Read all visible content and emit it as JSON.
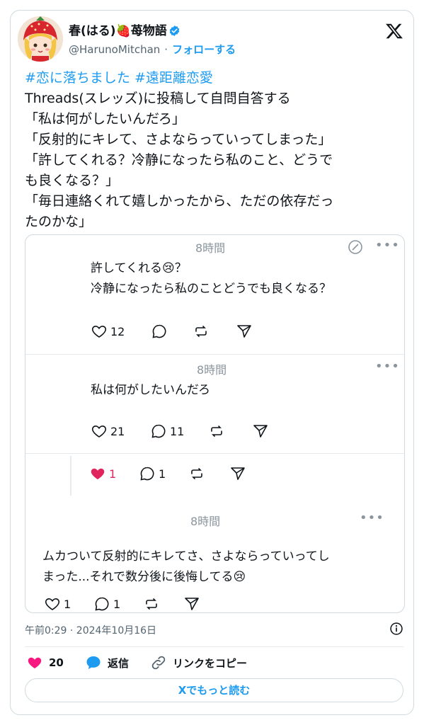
{
  "user": {
    "name": "春(はる)🍓苺物語",
    "handle": "@HarunoMitchan",
    "separator": "·",
    "follow": "フォローする"
  },
  "tweet": {
    "hashtag1": "#恋に落ちました",
    "hashtag2": "#遠距離恋愛",
    "lines": [
      "Threads(スレッズ)に投稿して自問自答する",
      "「私は何がしたいんだろ」",
      "「反射的にキレて、さよならっていってしまった」",
      "「許してくれる？冷静になったら私のこと、どうで",
      "も良くなる？」",
      "「毎日連絡くれて嬉しかったから、ただの依存だっ",
      "たのかな」"
    ]
  },
  "embedded": {
    "post1": {
      "time": "8時間",
      "line1": "許してくれる😢？",
      "line2": "冷静になったら私のことどうでも良くなる？",
      "likes": "12"
    },
    "post2": {
      "time": "8時間",
      "text": "私は何がしたいんだろ",
      "likes": "21",
      "replies": "11"
    },
    "reply": {
      "likes": "1",
      "replies": "1"
    },
    "post3": {
      "time": "8時間",
      "line1": "ムカついて反射的にキレてさ、さよならっていってし",
      "line2": "まった...それで数分後に後悔してる😢",
      "likes": "1",
      "replies": "1"
    },
    "more_label": "•••"
  },
  "meta": {
    "timestamp": "午前0:29 · 2024年10月16日"
  },
  "footer": {
    "likes": "20",
    "reply": "返信",
    "copy_link": "リンクをコピー",
    "read_more": "Xでもっと読む"
  },
  "colors": {
    "accent": "#1d9bf0",
    "like": "#f91880",
    "heart_red": "#e0245e"
  }
}
